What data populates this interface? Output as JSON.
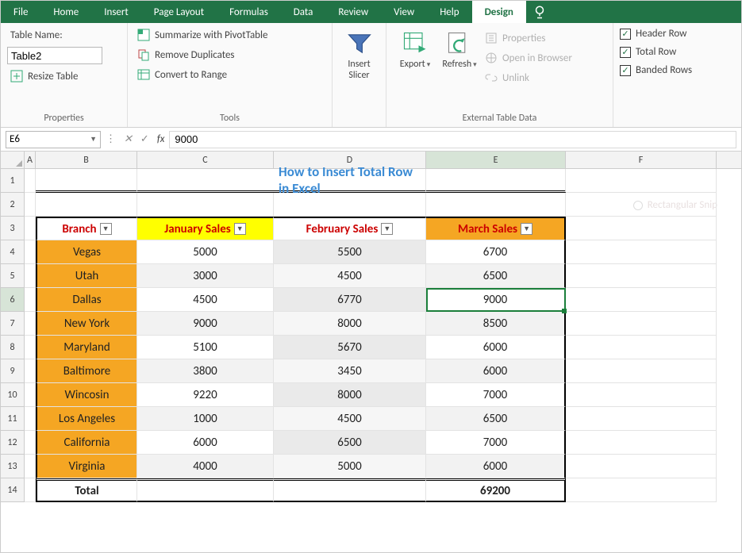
{
  "tabs": {
    "file": "File",
    "home": "Home",
    "insert": "Insert",
    "page_layout": "Page Layout",
    "formulas": "Formulas",
    "data": "Data",
    "review": "Review",
    "view": "View",
    "help": "Help",
    "design": "Design"
  },
  "ribbon": {
    "properties": {
      "label": "Properties",
      "table_name_lbl": "Table Name:",
      "table_name_value": "Table2",
      "resize": "Resize Table"
    },
    "tools": {
      "label": "Tools",
      "pivot": "Summarize with PivotTable",
      "dup": "Remove Duplicates",
      "range": "Convert to Range"
    },
    "slicer": {
      "line1": "Insert",
      "line2": "Slicer"
    },
    "ext": {
      "label": "External Table Data",
      "export": "Export",
      "refresh": "Refresh",
      "props": "Properties",
      "open": "Open in Browser",
      "unlink": "Unlink"
    },
    "styleopts": {
      "header": "Header Row",
      "total": "Total Row",
      "banded": "Banded Rows"
    }
  },
  "formulabar": {
    "cellref": "E6",
    "value": "9000"
  },
  "grid": {
    "columns": [
      "A",
      "B",
      "C",
      "D",
      "E",
      "F"
    ],
    "selected_col": "E",
    "selected_row": 6,
    "title": "How to Insert Total Row in Excel",
    "headers": {
      "branch": "Branch",
      "jan": "January Sales",
      "feb": "February Sales",
      "mar": "March Sales"
    },
    "rows": [
      {
        "b": "Vegas",
        "c": "5000",
        "d": "5500",
        "e": "6700"
      },
      {
        "b": "Utah",
        "c": "3000",
        "d": "4500",
        "e": "6500"
      },
      {
        "b": "Dallas",
        "c": "4500",
        "d": "6770",
        "e": "9000"
      },
      {
        "b": "New York",
        "c": "9000",
        "d": "8000",
        "e": "8500"
      },
      {
        "b": "Maryland",
        "c": "5100",
        "d": "5670",
        "e": "6000"
      },
      {
        "b": "Baltimore",
        "c": "3800",
        "d": "3450",
        "e": "6000"
      },
      {
        "b": "Wincosin",
        "c": "9220",
        "d": "8000",
        "e": "7000"
      },
      {
        "b": "Los Angeles",
        "c": "1000",
        "d": "4500",
        "e": "6500"
      },
      {
        "b": "California",
        "c": "6000",
        "d": "6500",
        "e": "7000"
      },
      {
        "b": "Virginia",
        "c": "4000",
        "d": "5000",
        "e": "6000"
      }
    ],
    "total": {
      "label": "Total",
      "e": "69200"
    }
  },
  "snip_label": "Rectangular Snip",
  "chart_data": {
    "type": "table",
    "title": "How to Insert Total Row in Excel",
    "columns": [
      "Branch",
      "January Sales",
      "February Sales",
      "March Sales"
    ],
    "rows": [
      [
        "Vegas",
        5000,
        5500,
        6700
      ],
      [
        "Utah",
        3000,
        4500,
        6500
      ],
      [
        "Dallas",
        4500,
        6770,
        9000
      ],
      [
        "New York",
        9000,
        8000,
        8500
      ],
      [
        "Maryland",
        5100,
        5670,
        6000
      ],
      [
        "Baltimore",
        3800,
        3450,
        6000
      ],
      [
        "Wincosin",
        9220,
        8000,
        7000
      ],
      [
        "Los Angeles",
        1000,
        4500,
        6500
      ],
      [
        "California",
        6000,
        6500,
        7000
      ],
      [
        "Virginia",
        4000,
        5000,
        6000
      ]
    ],
    "total_row": [
      "Total",
      null,
      null,
      69200
    ]
  }
}
